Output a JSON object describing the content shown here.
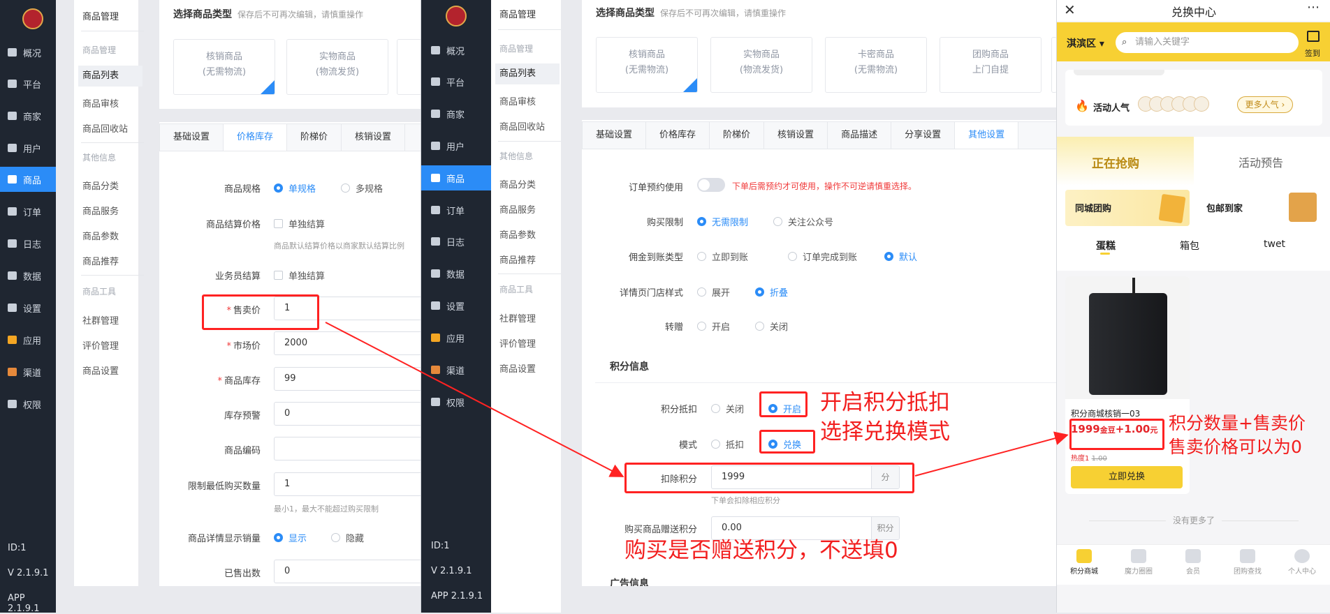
{
  "left_admin": {
    "nav": [
      {
        "label": "概况",
        "icon": "dashboard-icon"
      },
      {
        "label": "平台",
        "icon": "monitor-icon"
      },
      {
        "label": "商家",
        "icon": "shop-icon"
      },
      {
        "label": "用户",
        "icon": "user-icon"
      },
      {
        "label": "商品",
        "icon": "goods-icon"
      },
      {
        "label": "订单",
        "icon": "order-icon"
      },
      {
        "label": "日志",
        "icon": "log-icon"
      },
      {
        "label": "数据",
        "icon": "chart-icon"
      },
      {
        "label": "设置",
        "icon": "gear-icon"
      },
      {
        "label": "应用",
        "icon": "apps-icon"
      },
      {
        "label": "渠道",
        "icon": "channel-icon"
      },
      {
        "label": "权限",
        "icon": "lock-icon"
      }
    ],
    "footer": {
      "id": "ID:1",
      "version": "V 2.1.9.1",
      "app": "APP 2.1.9.1"
    },
    "submenu": {
      "title": "商品管理",
      "group1": "商品管理",
      "items1": [
        "商品列表",
        "商品审核",
        "商品回收站"
      ],
      "group2": "其他信息",
      "items2": [
        "商品分类",
        "商品服务",
        "商品参数",
        "商品推荐"
      ],
      "group3": "商品工具",
      "items3": [
        "社群管理",
        "评价管理",
        "商品设置"
      ]
    },
    "content": {
      "section_title": "选择商品类型",
      "section_note": "保存后不可再次编辑，请慎重操作",
      "types": [
        {
          "name": "核销商品",
          "desc": "(无需物流)"
        },
        {
          "name": "实物商品",
          "desc": "(物流发货)"
        }
      ],
      "tabs": [
        "基础设置",
        "价格库存",
        "阶梯价",
        "核销设置"
      ],
      "form": {
        "spec_label": "商品规格",
        "spec_single": "单规格",
        "spec_multi": "多规格",
        "settle_label": "商品结算价格",
        "settle_check": "单独结算",
        "settle_hint": "商品默认结算价格以商家默认结算比例",
        "sales_label": "业务员结算",
        "sales_check": "单独结算",
        "price_label": "售卖价",
        "price_value": "1",
        "market_label": "市场价",
        "market_value": "2000",
        "stock_label": "商品库存",
        "stock_value": "99",
        "warn_label": "库存预警",
        "warn_value": "0",
        "code_label": "商品编码",
        "code_value": "",
        "minbuy_label": "限制最低购买数量",
        "minbuy_value": "1",
        "minbuy_hint": "最小1，最大不能超过购买限制",
        "showsales_label": "商品详情显示销量",
        "show": "显示",
        "hide": "隐藏",
        "sold_label": "已售出数",
        "sold_value": "0"
      }
    }
  },
  "mid_admin": {
    "section_title": "选择商品类型",
    "section_note": "保存后不可再次编辑，请慎重操作",
    "types": [
      {
        "name": "核销商品",
        "desc": "(无需物流)"
      },
      {
        "name": "实物商品",
        "desc": "(物流发货)"
      },
      {
        "name": "卡密商品",
        "desc": "(无需物流)"
      },
      {
        "name": "团购商品",
        "desc": "上门自提"
      }
    ],
    "tabs": [
      "基础设置",
      "价格库存",
      "阶梯价",
      "核销设置",
      "商品描述",
      "分享设置",
      "其他设置"
    ],
    "form": {
      "reserve_label": "订单预约使用",
      "reserve_warn": "下单后需预约才可使用，操作不可逆请慎重选择。",
      "limit_label": "购买限制",
      "limit_none": "无需限制",
      "limit_follow": "关注公众号",
      "commission_label": "佣金到账类型",
      "commission_now": "立即到账",
      "commission_done": "订单完成到账",
      "commission_default": "默认",
      "store_label": "详情页门店样式",
      "store_expand": "展开",
      "store_fold": "折叠",
      "gift_label": "转赠",
      "gift_on": "开启",
      "gift_off": "关闭",
      "points_section": "积分信息",
      "deduct_label": "积分抵扣",
      "deduct_off": "关闭",
      "deduct_on": "开启",
      "mode_label": "模式",
      "mode_offset": "抵扣",
      "mode_exchange": "兑换",
      "deduct_points_label": "扣除积分",
      "deduct_points_value": "1999",
      "deduct_points_unit": "分",
      "deduct_points_hint": "下单会扣除相应积分",
      "gift_points_label": "购买商品赠送积分",
      "gift_points_value": "0.00",
      "gift_points_unit": "积分",
      "ad_section": "广告信息"
    }
  },
  "annotations": {
    "enable_deduct": "开启积分抵扣",
    "choose_exchange": "选择兑换模式",
    "gift_points": "购买是否赠送积分，不送填0",
    "phone_note1": "积分数量+售卖价",
    "phone_note2": "售卖价格可以为0"
  },
  "phone": {
    "title": "兑换中心",
    "location": "淇滨区",
    "search_placeholder": "请输入关键字",
    "checkin": "签到",
    "popularity_label": "活动人气",
    "more_popularity": "更多人气",
    "tab_active": "正在抢购",
    "tab_preview": "活动预告",
    "cat_local": "同城团购",
    "cat_shipping": "包邮到家",
    "subcats": [
      "蛋糕",
      "箱包",
      "twet"
    ],
    "product": {
      "name": "积分商城核销一03",
      "points": "1999",
      "points_unit": "金豆",
      "plus": "+",
      "price": "1.00",
      "price_unit": "元",
      "heat": "热度1",
      "old_price": "1.00",
      "button": "立即兑换"
    },
    "no_more": "没有更多了",
    "bottom_nav": [
      "积分商城",
      "魔力圈圈",
      "会员",
      "团购查找",
      "个人中心"
    ],
    "colors": {
      "accent": "#f7d033",
      "price_red": "#e5262b",
      "link_blue": "#2b8cf7",
      "annotation_red": "#f21e1e"
    }
  }
}
